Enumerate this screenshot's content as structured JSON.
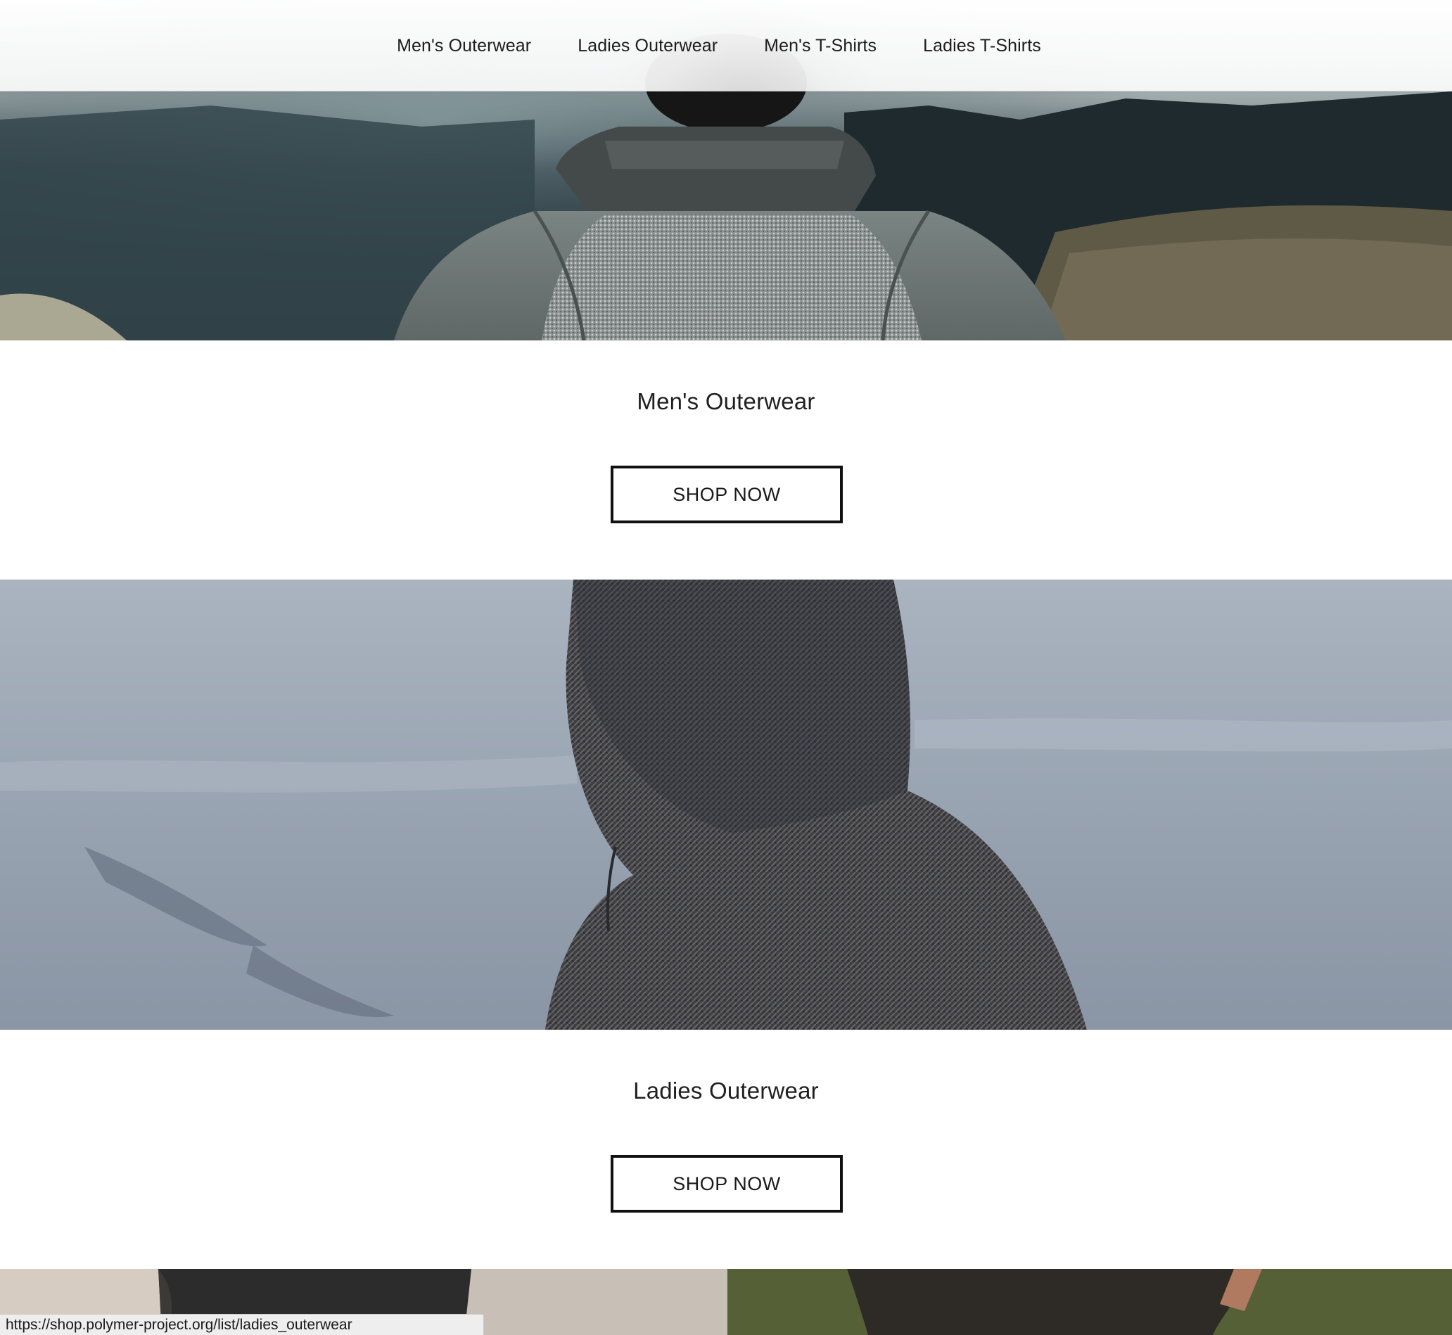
{
  "nav": {
    "tabs": [
      {
        "label": "Men's Outerwear"
      },
      {
        "label": "Ladies Outerwear"
      },
      {
        "label": "Men's T-Shirts"
      },
      {
        "label": "Ladies T-Shirts"
      }
    ]
  },
  "categories": [
    {
      "title": "Men's Outerwear",
      "button_label": "SHOP NOW"
    },
    {
      "title": "Ladies Outerwear",
      "button_label": "SHOP NOW"
    }
  ],
  "status_bar": {
    "url": "https://shop.polymer-project.org/list/ladies_outerwear"
  },
  "colors": {
    "text": "#202020",
    "button_border": "#111111",
    "background": "#ffffff",
    "status_bar_bg": "#eeeeee"
  }
}
